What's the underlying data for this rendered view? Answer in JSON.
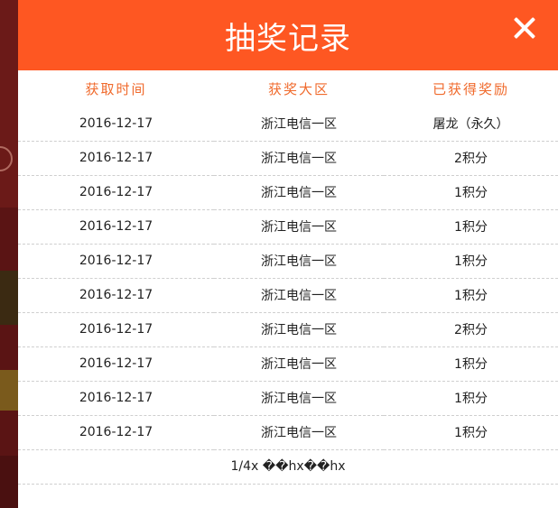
{
  "modal": {
    "title": "抽奖记录",
    "close_icon": "close-icon",
    "header_color": "#fe5722"
  },
  "table": {
    "headers": [
      "获取时间",
      "获奖大区",
      "已获得奖励"
    ],
    "rows": [
      [
        "2016-12-17",
        "浙江电信一区",
        "屠龙（永久）"
      ],
      [
        "2016-12-17",
        "浙江电信一区",
        "2积分"
      ],
      [
        "2016-12-17",
        "浙江电信一区",
        "1积分"
      ],
      [
        "2016-12-17",
        "浙江电信一区",
        "1积分"
      ],
      [
        "2016-12-17",
        "浙江电信一区",
        "1积分"
      ],
      [
        "2016-12-17",
        "浙江电信一区",
        "1积分"
      ],
      [
        "2016-12-17",
        "浙江电信一区",
        "2积分"
      ],
      [
        "2016-12-17",
        "浙江电信一区",
        "1积分"
      ],
      [
        "2016-12-17",
        "浙江电信一区",
        "1积分"
      ],
      [
        "2016-12-17",
        "浙江电信一区",
        "1积分"
      ]
    ]
  },
  "pager": {
    "text": "1/4x ��hx��hx"
  }
}
